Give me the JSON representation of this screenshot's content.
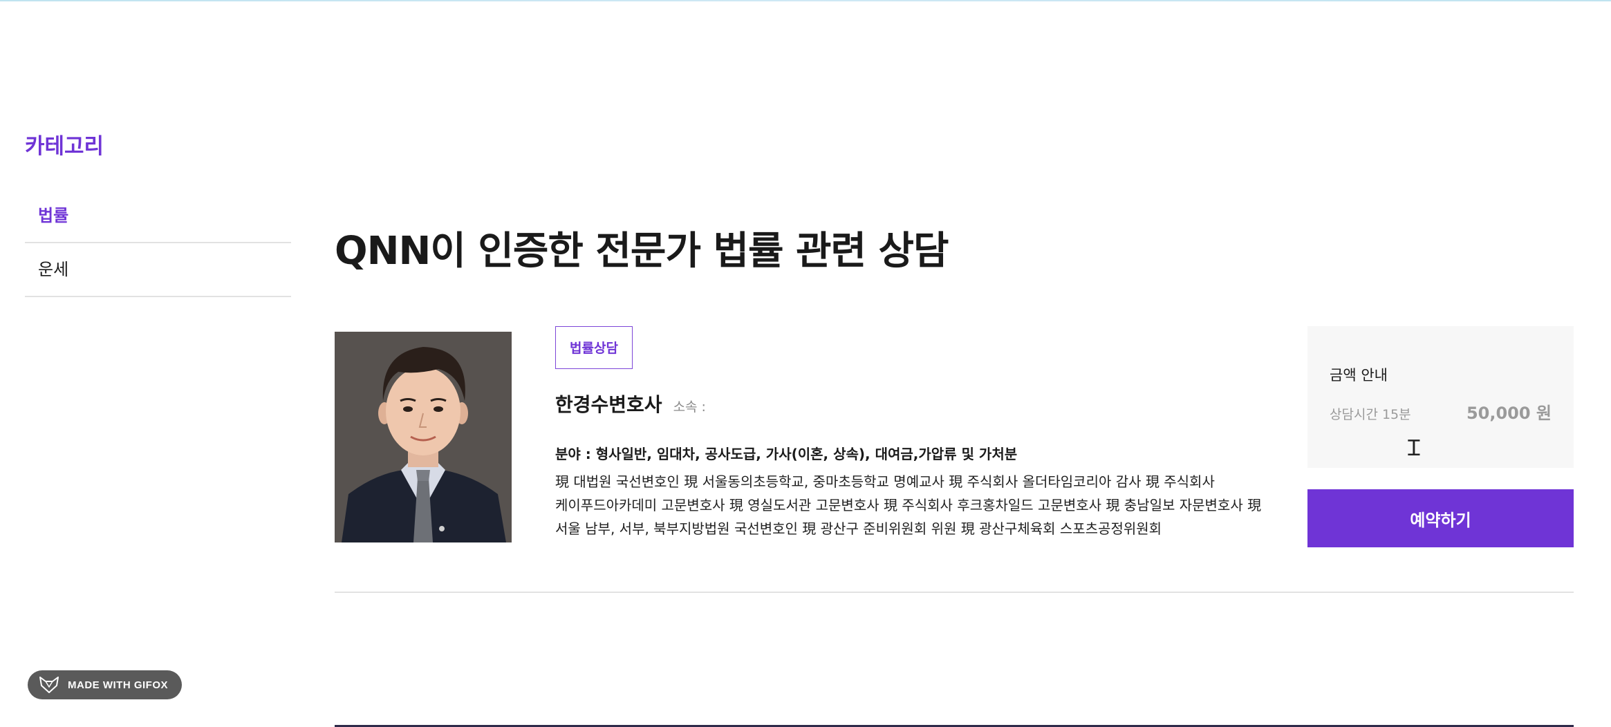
{
  "sidebar": {
    "title": "카테고리",
    "items": [
      {
        "label": "법률",
        "active": true
      },
      {
        "label": "운세",
        "active": false
      }
    ]
  },
  "main": {
    "title": "QNN이 인증한 전문가 법률 관련 상담"
  },
  "expert": {
    "tag": "법률상담",
    "name": "한경수변호사",
    "affiliation": "소속 :",
    "field": "분야 : 형사일반, 임대차, 공사도급, 가사(이혼, 상속), 대여금,가압류 및 가처분",
    "description": "現 대법원 국선변호인 現 서울동의초등학교, 중마초등학교 명예교사 現 주식회사 올더타임코리아 감사 現 주식회사 케이푸드아카데미 고문변호사 現 영실도서관 고문변호사 現 주식회사 후크홍차일드 고문변호사 現 충남일보 자문변호사 現 서울 남부, 서부, 북부지방법원 국선변호인 現 광산구 준비위원회 위원 現 광산구체육회 스포츠공정위원회"
  },
  "price": {
    "title": "금액 안내",
    "time_label": "상담시간 15분",
    "amount": "50,000 원"
  },
  "reserve_button": "예약하기",
  "watermark": "MADE WITH GIFOX",
  "colors": {
    "accent": "#6f34d6",
    "price_bg": "#f7f7f7",
    "divider": "#e2e2e2"
  }
}
